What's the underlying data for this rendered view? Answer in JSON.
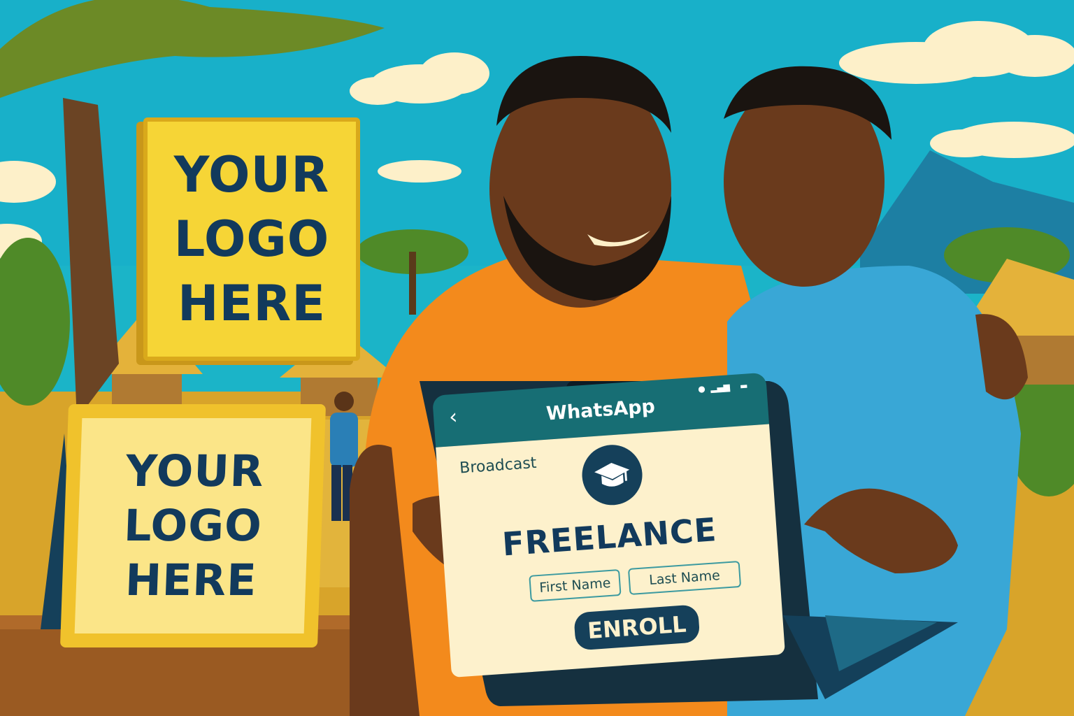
{
  "signs": {
    "top_text": "YOUR\nLOGO\nHERE",
    "bottom_text": "YOUR\nLOGO\nHERE"
  },
  "app": {
    "title": "WhatsApp",
    "back_icon": "chevron-left-icon",
    "status_icons": [
      "location-icon",
      "signal-icon",
      "battery-icon"
    ],
    "section_label": "Broadcast",
    "badge_icon": "graduation-cap-icon",
    "headline": "FREELANCE",
    "first_name_placeholder": "First Name",
    "last_name_placeholder": "Last Name",
    "enroll_label": "ENROLL"
  },
  "colors": {
    "sky": "#1bb4c8",
    "sign_yellow": "#f6d536",
    "sign_text": "#123a5c",
    "app_bar": "#176e74",
    "screen_bg": "#fdf1cc",
    "button": "#15405a"
  }
}
